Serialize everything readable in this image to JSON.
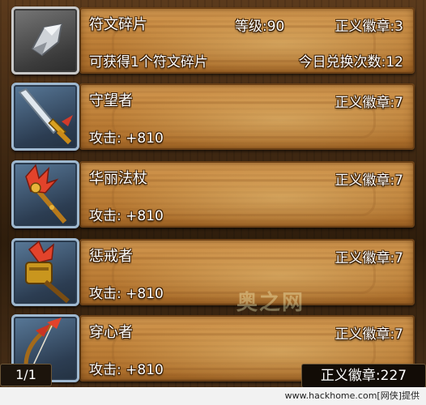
{
  "items": [
    {
      "name": "符文碎片",
      "level_text": "等级:90",
      "cost_text": "正义徽章:3",
      "sub_left": "可获得1个符文碎片",
      "sub_right": "今日兑换次数:12",
      "icon": "rune-shard-icon"
    },
    {
      "name": "守望者",
      "cost_text": "正义徽章:7",
      "sub_left": "攻击: +810",
      "icon": "sword-icon"
    },
    {
      "name": "华丽法杖",
      "cost_text": "正义徽章:7",
      "sub_left": "攻击: +810",
      "icon": "staff-icon"
    },
    {
      "name": "惩戒者",
      "cost_text": "正义徽章:7",
      "sub_left": "攻击: +810",
      "icon": "hammer-icon"
    },
    {
      "name": "穿心者",
      "cost_text": "正义徽章:7",
      "sub_left": "攻击: +810",
      "icon": "bow-icon"
    }
  ],
  "pagination": "1/1",
  "badge_total": "正义徽章:227",
  "watermark": "奥之网",
  "footer_credit": "www.hackhome.com[网侠]提供",
  "colors": {
    "plank": "#c0823a",
    "text": "#ffffff",
    "frame_blue": "#5b7c9c"
  }
}
